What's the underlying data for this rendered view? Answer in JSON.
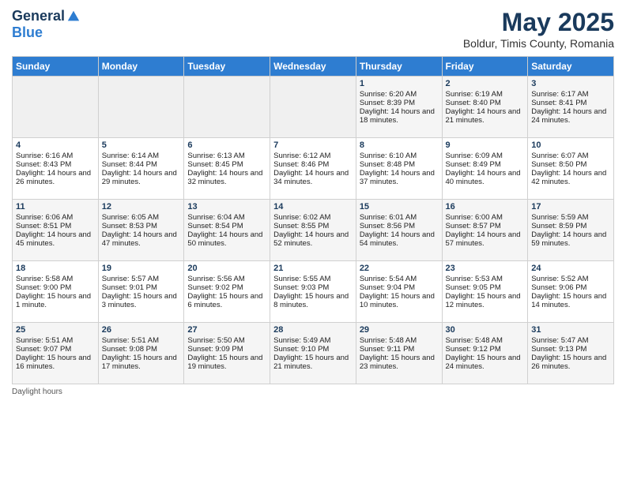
{
  "header": {
    "logo_general": "General",
    "logo_blue": "Blue",
    "month_title": "May 2025",
    "subtitle": "Boldur, Timis County, Romania"
  },
  "days_of_week": [
    "Sunday",
    "Monday",
    "Tuesday",
    "Wednesday",
    "Thursday",
    "Friday",
    "Saturday"
  ],
  "footer": {
    "daylight_hours_label": "Daylight hours"
  },
  "weeks": [
    [
      {
        "day": "",
        "empty": true
      },
      {
        "day": "",
        "empty": true
      },
      {
        "day": "",
        "empty": true
      },
      {
        "day": "",
        "empty": true
      },
      {
        "day": "1",
        "sunrise": "6:20 AM",
        "sunset": "8:39 PM",
        "daylight": "14 hours and 18 minutes."
      },
      {
        "day": "2",
        "sunrise": "6:19 AM",
        "sunset": "8:40 PM",
        "daylight": "14 hours and 21 minutes."
      },
      {
        "day": "3",
        "sunrise": "6:17 AM",
        "sunset": "8:41 PM",
        "daylight": "14 hours and 24 minutes."
      }
    ],
    [
      {
        "day": "4",
        "sunrise": "6:16 AM",
        "sunset": "8:43 PM",
        "daylight": "14 hours and 26 minutes."
      },
      {
        "day": "5",
        "sunrise": "6:14 AM",
        "sunset": "8:44 PM",
        "daylight": "14 hours and 29 minutes."
      },
      {
        "day": "6",
        "sunrise": "6:13 AM",
        "sunset": "8:45 PM",
        "daylight": "14 hours and 32 minutes."
      },
      {
        "day": "7",
        "sunrise": "6:12 AM",
        "sunset": "8:46 PM",
        "daylight": "14 hours and 34 minutes."
      },
      {
        "day": "8",
        "sunrise": "6:10 AM",
        "sunset": "8:48 PM",
        "daylight": "14 hours and 37 minutes."
      },
      {
        "day": "9",
        "sunrise": "6:09 AM",
        "sunset": "8:49 PM",
        "daylight": "14 hours and 40 minutes."
      },
      {
        "day": "10",
        "sunrise": "6:07 AM",
        "sunset": "8:50 PM",
        "daylight": "14 hours and 42 minutes."
      }
    ],
    [
      {
        "day": "11",
        "sunrise": "6:06 AM",
        "sunset": "8:51 PM",
        "daylight": "14 hours and 45 minutes."
      },
      {
        "day": "12",
        "sunrise": "6:05 AM",
        "sunset": "8:53 PM",
        "daylight": "14 hours and 47 minutes."
      },
      {
        "day": "13",
        "sunrise": "6:04 AM",
        "sunset": "8:54 PM",
        "daylight": "14 hours and 50 minutes."
      },
      {
        "day": "14",
        "sunrise": "6:02 AM",
        "sunset": "8:55 PM",
        "daylight": "14 hours and 52 minutes."
      },
      {
        "day": "15",
        "sunrise": "6:01 AM",
        "sunset": "8:56 PM",
        "daylight": "14 hours and 54 minutes."
      },
      {
        "day": "16",
        "sunrise": "6:00 AM",
        "sunset": "8:57 PM",
        "daylight": "14 hours and 57 minutes."
      },
      {
        "day": "17",
        "sunrise": "5:59 AM",
        "sunset": "8:59 PM",
        "daylight": "14 hours and 59 minutes."
      }
    ],
    [
      {
        "day": "18",
        "sunrise": "5:58 AM",
        "sunset": "9:00 PM",
        "daylight": "15 hours and 1 minute."
      },
      {
        "day": "19",
        "sunrise": "5:57 AM",
        "sunset": "9:01 PM",
        "daylight": "15 hours and 3 minutes."
      },
      {
        "day": "20",
        "sunrise": "5:56 AM",
        "sunset": "9:02 PM",
        "daylight": "15 hours and 6 minutes."
      },
      {
        "day": "21",
        "sunrise": "5:55 AM",
        "sunset": "9:03 PM",
        "daylight": "15 hours and 8 minutes."
      },
      {
        "day": "22",
        "sunrise": "5:54 AM",
        "sunset": "9:04 PM",
        "daylight": "15 hours and 10 minutes."
      },
      {
        "day": "23",
        "sunrise": "5:53 AM",
        "sunset": "9:05 PM",
        "daylight": "15 hours and 12 minutes."
      },
      {
        "day": "24",
        "sunrise": "5:52 AM",
        "sunset": "9:06 PM",
        "daylight": "15 hours and 14 minutes."
      }
    ],
    [
      {
        "day": "25",
        "sunrise": "5:51 AM",
        "sunset": "9:07 PM",
        "daylight": "15 hours and 16 minutes."
      },
      {
        "day": "26",
        "sunrise": "5:51 AM",
        "sunset": "9:08 PM",
        "daylight": "15 hours and 17 minutes."
      },
      {
        "day": "27",
        "sunrise": "5:50 AM",
        "sunset": "9:09 PM",
        "daylight": "15 hours and 19 minutes."
      },
      {
        "day": "28",
        "sunrise": "5:49 AM",
        "sunset": "9:10 PM",
        "daylight": "15 hours and 21 minutes."
      },
      {
        "day": "29",
        "sunrise": "5:48 AM",
        "sunset": "9:11 PM",
        "daylight": "15 hours and 23 minutes."
      },
      {
        "day": "30",
        "sunrise": "5:48 AM",
        "sunset": "9:12 PM",
        "daylight": "15 hours and 24 minutes."
      },
      {
        "day": "31",
        "sunrise": "5:47 AM",
        "sunset": "9:13 PM",
        "daylight": "15 hours and 26 minutes."
      }
    ]
  ]
}
